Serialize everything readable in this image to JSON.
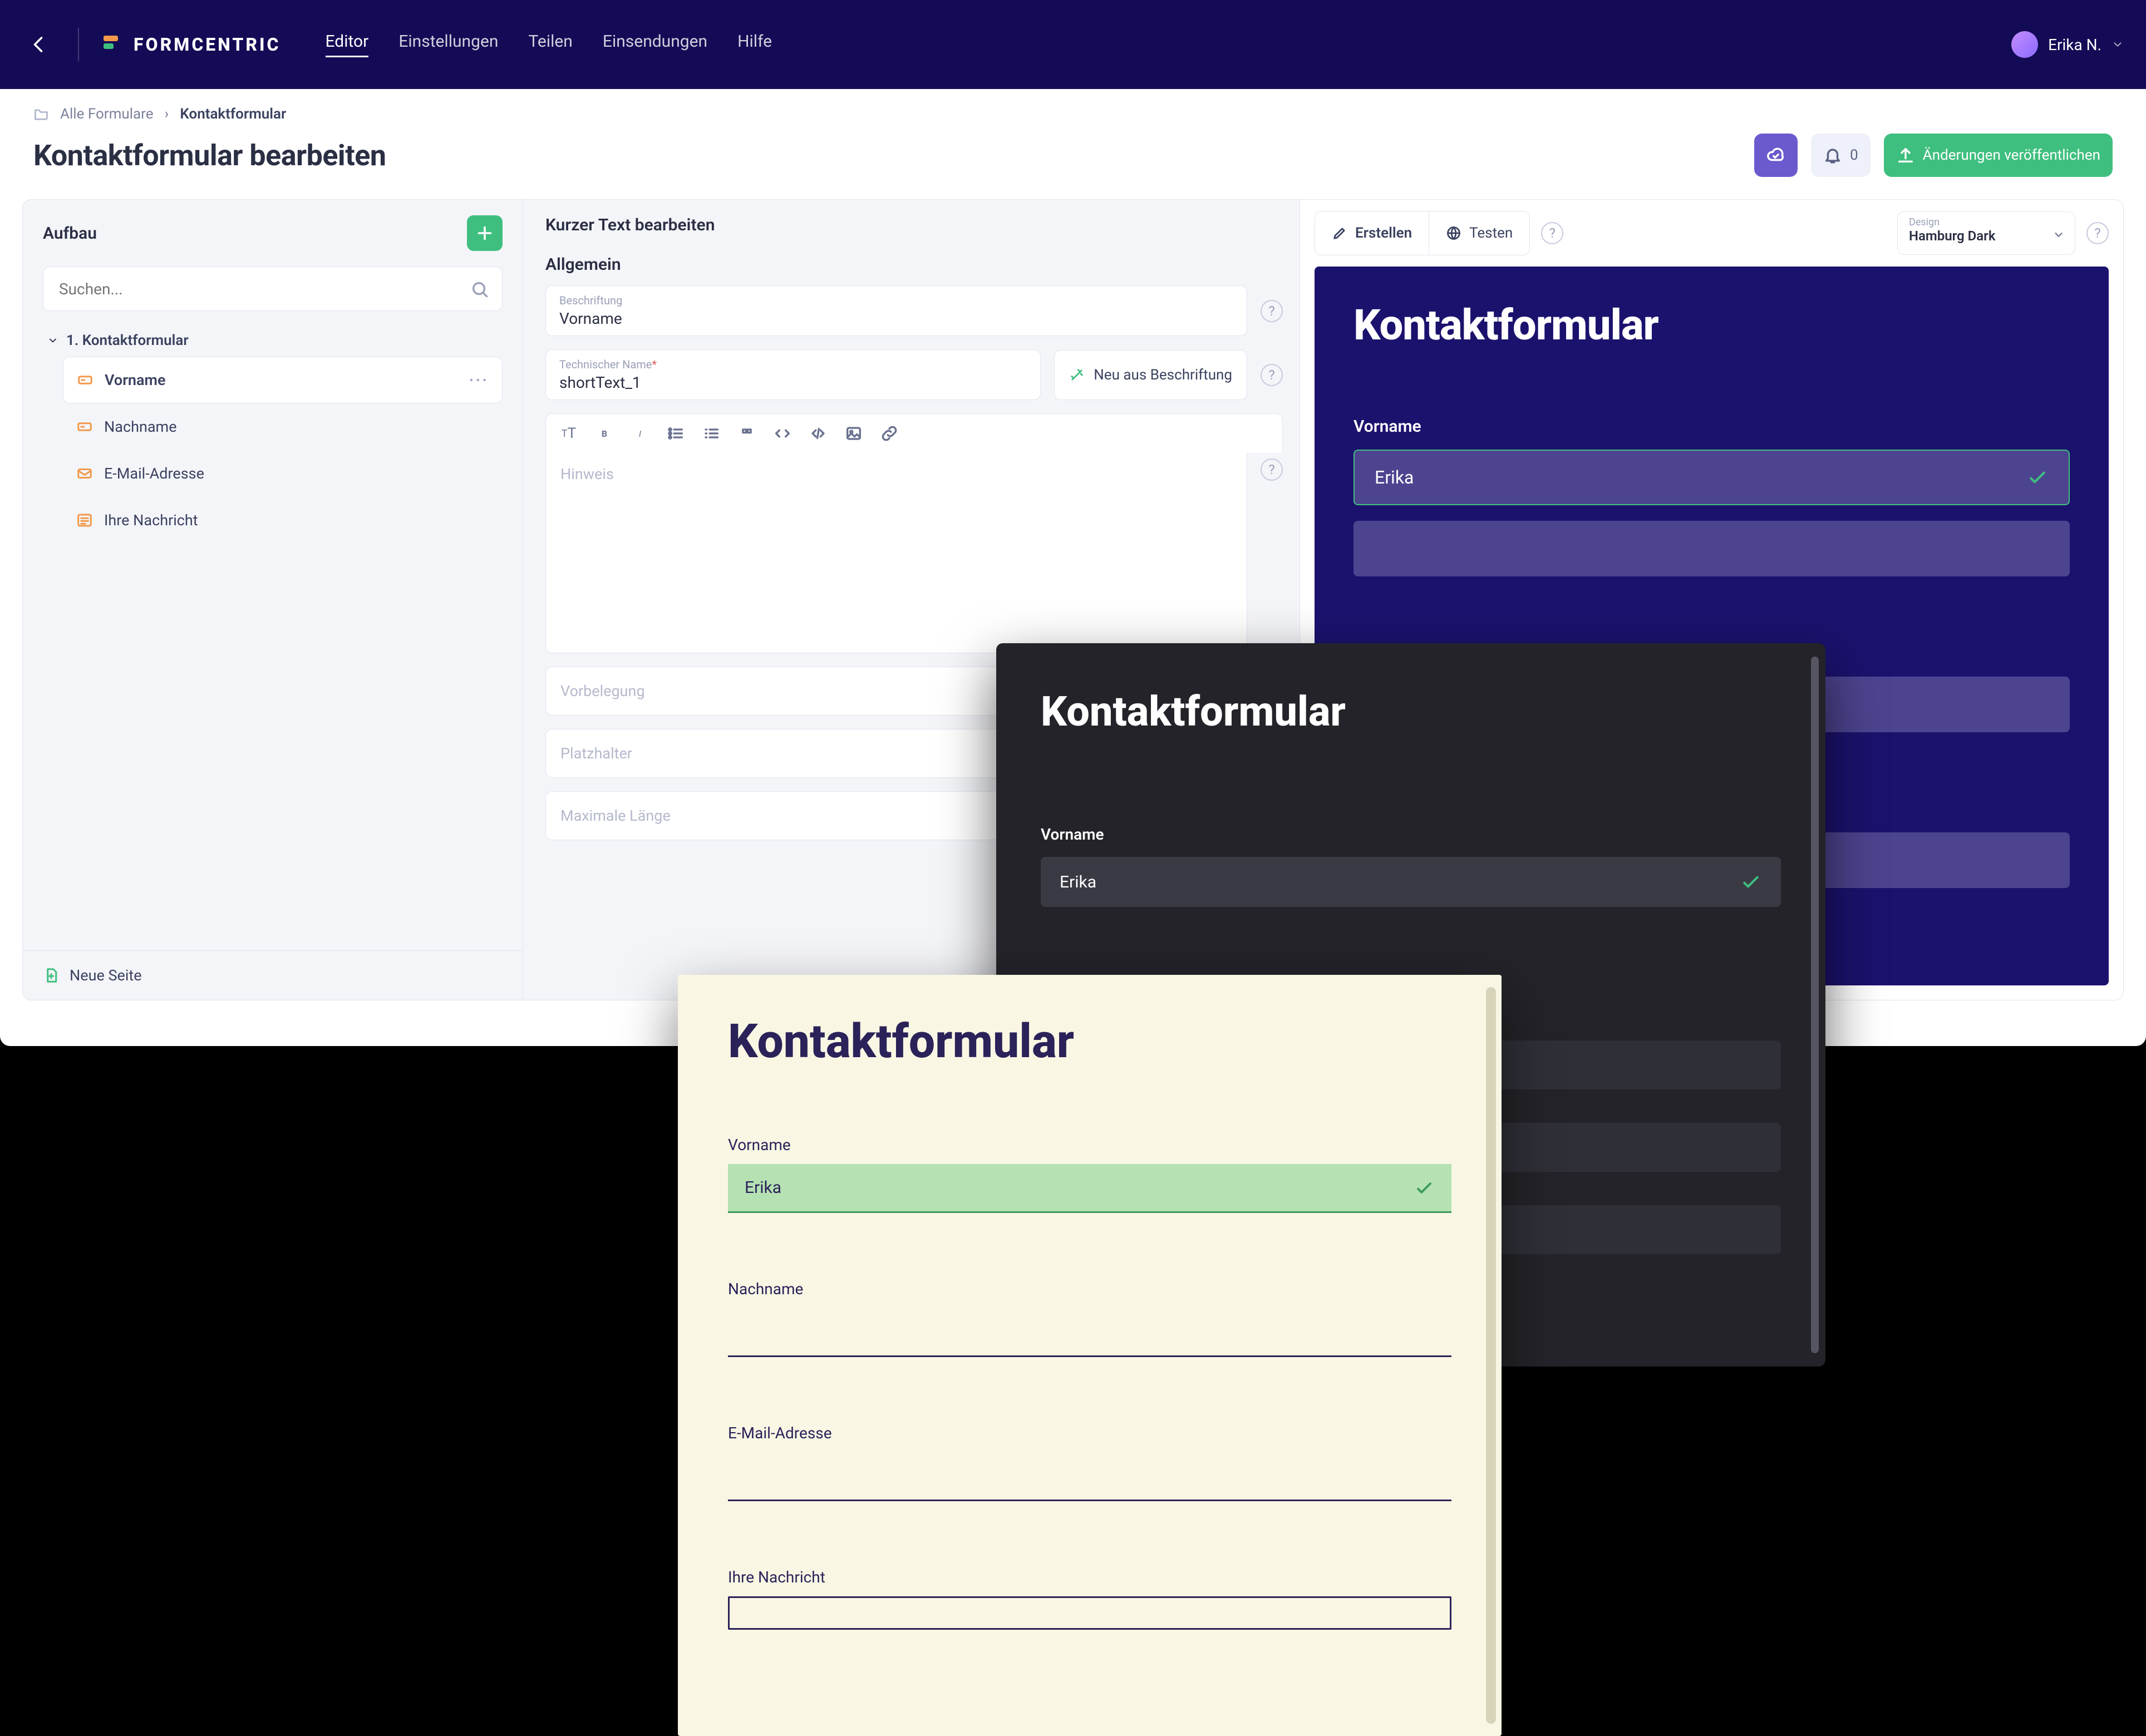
{
  "topbar": {
    "brand": "FORMCENTRIC",
    "nav": [
      "Editor",
      "Einstellungen",
      "Teilen",
      "Einsendungen",
      "Hilfe"
    ],
    "active_nav": 0,
    "user_name": "Erika N."
  },
  "breadcrumb": {
    "root": "Alle Formulare",
    "current": "Kontaktformular"
  },
  "page_title": "Kontaktformular bearbeiten",
  "actions": {
    "notifications_count": "0",
    "publish_label": "Änderungen veröffentlichen"
  },
  "left_panel": {
    "title": "Aufbau",
    "search_placeholder": "Suchen...",
    "root_label": "1. Kontaktformular",
    "items": [
      {
        "label": "Vorname",
        "icon": "short-text",
        "selected": true
      },
      {
        "label": "Nachname",
        "icon": "short-text"
      },
      {
        "label": "E-Mail-Adresse",
        "icon": "email"
      },
      {
        "label": "Ihre Nachricht",
        "icon": "long-text"
      }
    ],
    "new_page_label": "Neue Seite"
  },
  "mid_panel": {
    "title": "Kurzer Text bearbeiten",
    "section_general": "Allgemein",
    "label_field": {
      "label": "Beschriftung",
      "value": "Vorname"
    },
    "techname_field": {
      "label": "Technischer Name",
      "value": "shortText_1",
      "required": true
    },
    "new_from_label": "Neu aus Beschriftung",
    "hint_placeholder": "Hinweis",
    "default_label": "Vorbelegung",
    "placeholder_label": "Platzhalter",
    "maxlength_label": "Maximale Länge"
  },
  "right_panel": {
    "tab_edit": "Erstellen",
    "tab_test": "Testen",
    "design_label": "Design",
    "design_value": "Hamburg Dark"
  },
  "preview_navy": {
    "title": "Kontaktformular",
    "field_label": "Vorname",
    "field_value": "Erika"
  },
  "preview_dark": {
    "title": "Kontaktformular",
    "field_label": "Vorname",
    "field_value": "Erika"
  },
  "preview_cream": {
    "title": "Kontaktformular",
    "fields": [
      {
        "label": "Vorname",
        "value": "Erika",
        "filled": true
      },
      {
        "label": "Nachname"
      },
      {
        "label": "E-Mail-Adresse"
      },
      {
        "label": "Ihre Nachricht",
        "textarea": true
      }
    ]
  }
}
